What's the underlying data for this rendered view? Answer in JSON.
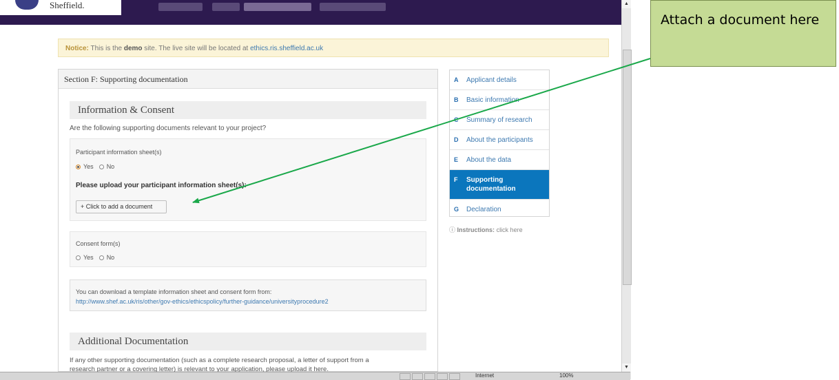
{
  "header": {
    "logo_text": "Sheffield.",
    "nav_items": [
      "",
      "",
      "",
      ""
    ]
  },
  "notice": {
    "label": "Notice:",
    "text_before": " This is the ",
    "bold": "demo",
    "text_after": " site. The live site will be located at ",
    "link": "ethics.ris.sheffield.ac.uk"
  },
  "section": {
    "title": "Section F: Supporting documentation",
    "info_consent": {
      "heading": "Information & Consent",
      "question": "Are the following supporting documents relevant to your project?",
      "participant_sheet": {
        "label": "Participant information sheet(s)",
        "yes": "Yes",
        "no": "No",
        "selected": "Yes",
        "upload_prompt": "Please upload your participant information sheet(s):",
        "button": "+ Click to add a document"
      },
      "consent_form": {
        "label": "Consent form(s)",
        "yes": "Yes",
        "no": "No"
      },
      "template_note": "You can download a template information sheet and consent form from:",
      "template_link": "http://www.shef.ac.uk/ris/other/gov-ethics/ethicspolicy/further-guidance/universityprocedure2"
    },
    "additional": {
      "heading": "Additional Documentation",
      "text_line1": "If any other supporting documentation (such as a complete research proposal, a letter of support from a",
      "text_line2": "research partner or a covering letter) is relevant to your application, please upload it here."
    }
  },
  "steps": [
    {
      "letter": "A",
      "label": "Applicant details"
    },
    {
      "letter": "B",
      "label": "Basic information"
    },
    {
      "letter": "C",
      "label": "Summary of research"
    },
    {
      "letter": "D",
      "label": "About the participants"
    },
    {
      "letter": "E",
      "label": "About the data"
    },
    {
      "letter": "F",
      "label": "Supporting documentation"
    },
    {
      "letter": "G",
      "label": "Declaration"
    }
  ],
  "active_step": "F",
  "instructions": {
    "label": "Instructions:",
    "link": "click here"
  },
  "callout": {
    "text": "Attach a document here"
  },
  "statusbar": {
    "zone": "Internet",
    "zoom": "100%"
  },
  "colors": {
    "header_purple": "#2d1a4f",
    "active_step": "#0b76bd",
    "callout_fill": "#c5db95",
    "arrow": "#1aa84a",
    "link": "#3d79b0"
  }
}
